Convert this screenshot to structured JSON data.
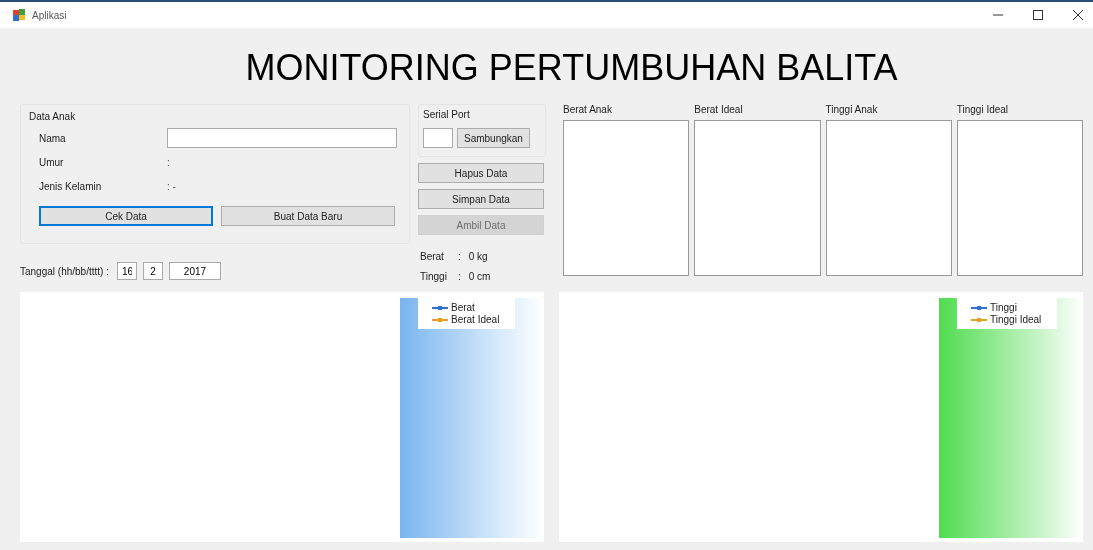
{
  "window": {
    "title": "Aplikasi"
  },
  "heading": "MONITORING PERTUMBUHAN BALITA",
  "data_anak": {
    "title": "Data Anak",
    "fields": [
      {
        "label": "Nama",
        "kind": "input"
      },
      {
        "label": "Umur",
        "kind": "text",
        "value": ":"
      },
      {
        "label": "Jenis Kelamin",
        "kind": "text",
        "value": ": -"
      }
    ],
    "buttons": [
      {
        "label": "Cek Data",
        "selected": true
      },
      {
        "label": "Buat Data Baru",
        "selected": false
      }
    ]
  },
  "tanggal": {
    "label": "Tanggal (hh/bb/tttt) :",
    "day": "16",
    "month": "2",
    "year": "2017"
  },
  "serial_port": {
    "title": "Serial Port",
    "connect_button": "Sambungkan"
  },
  "actions": [
    {
      "label": "Hapus Data",
      "disabled": false
    },
    {
      "label": "Simpan Data",
      "disabled": false
    },
    {
      "label": "Ambil Data",
      "disabled": true
    }
  ],
  "readings": [
    {
      "label": "Berat",
      "separator": ":",
      "value": "0 kg"
    },
    {
      "label": "Tinggi",
      "separator": ":",
      "value": "0 cm"
    }
  ],
  "lists": [
    {
      "label": "Berat Anak"
    },
    {
      "label": "Berat Ideal"
    },
    {
      "label": "Tinggi Anak"
    },
    {
      "label": "Tinggi Ideal"
    }
  ],
  "charts": [
    {
      "kind": "blue",
      "legend": [
        {
          "name": "Berat",
          "color": "#3070d0"
        },
        {
          "name": "Berat Ideal",
          "color": "#e0a020"
        }
      ]
    },
    {
      "kind": "green",
      "legend": [
        {
          "name": "Tinggi",
          "color": "#3070d0"
        },
        {
          "name": "Tinggi Ideal",
          "color": "#e0a020"
        }
      ]
    }
  ]
}
